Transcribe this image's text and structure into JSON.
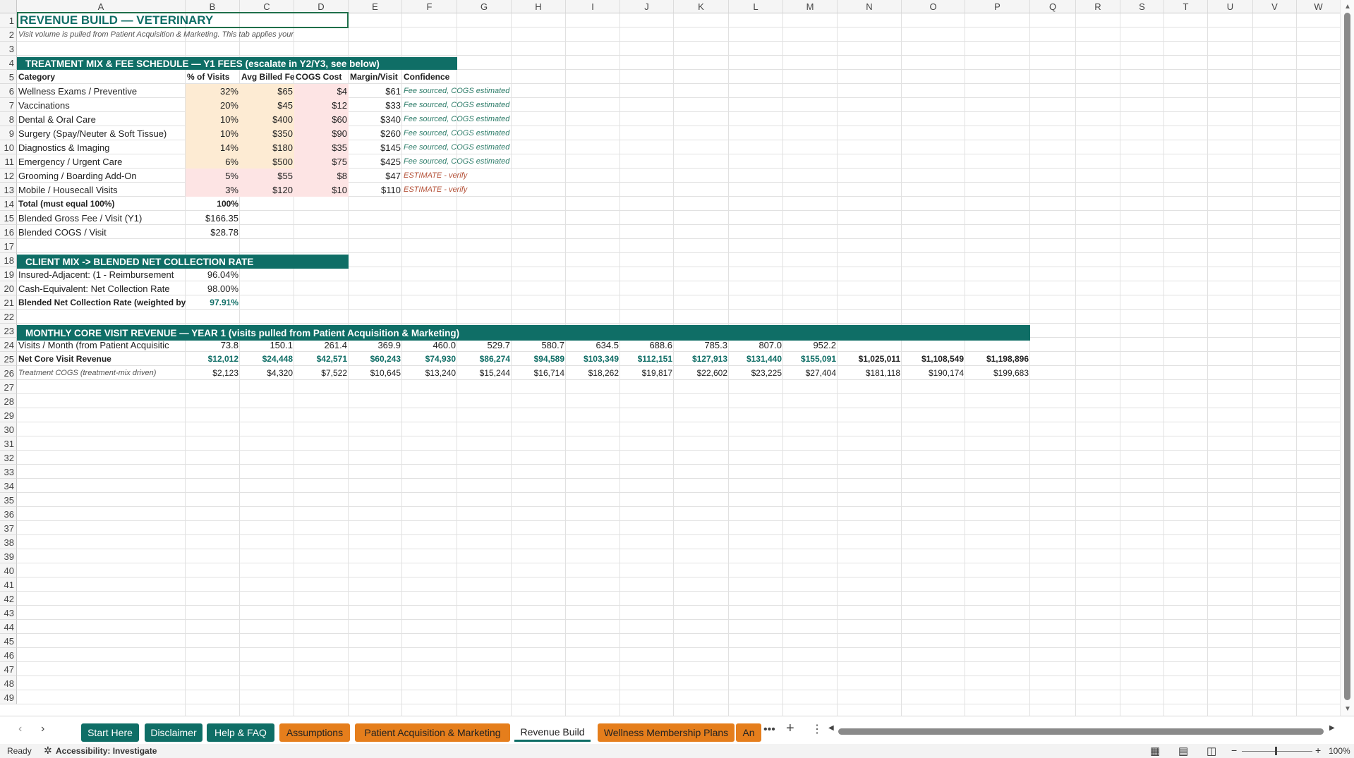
{
  "columns": [
    "A",
    "B",
    "C",
    "D",
    "E",
    "F",
    "G",
    "H",
    "I",
    "J",
    "K",
    "L",
    "M",
    "N",
    "O",
    "P",
    "Q",
    "R",
    "S",
    "T",
    "U",
    "V",
    "W"
  ],
  "rows": [
    "1",
    "2",
    "3",
    "4",
    "5",
    "6",
    "7",
    "8",
    "9",
    "10",
    "11",
    "12",
    "13",
    "14",
    "15",
    "16",
    "17",
    "18",
    "19",
    "20",
    "21",
    "22",
    "23",
    "24",
    "25",
    "26",
    "27",
    "28",
    "29",
    "30",
    "31",
    "32",
    "33",
    "34",
    "35",
    "36",
    "37",
    "38",
    "39",
    "40",
    "41",
    "42",
    "43",
    "44",
    "45",
    "46",
    "47",
    "48",
    "49"
  ],
  "title": "REVENUE BUILD — VETERINARY",
  "subtitle": "Visit volume is pulled from Patient Acquisition & Marketing. This tab applies your treatm",
  "section1": "TREATMENT MIX & FEE SCHEDULE — Y1 FEES (escalate in Y2/Y3, see below)",
  "headers": [
    "Category",
    "% of Visits",
    "Avg Billed Fee",
    "COGS Cost",
    "Margin/Visit",
    "Confidence"
  ],
  "treatments": [
    {
      "category": "Wellness Exams / Preventive",
      "pct": "32%",
      "fee": "$65",
      "cogs": "$4",
      "margin": "$61",
      "conf": "Fee sourced, COGS estimated"
    },
    {
      "category": "Vaccinations",
      "pct": "20%",
      "fee": "$45",
      "cogs": "$12",
      "margin": "$33",
      "conf": "Fee sourced, COGS estimated"
    },
    {
      "category": "Dental & Oral Care",
      "pct": "10%",
      "fee": "$400",
      "cogs": "$60",
      "margin": "$340",
      "conf": "Fee sourced, COGS estimated"
    },
    {
      "category": "Surgery (Spay/Neuter & Soft Tissue)",
      "pct": "10%",
      "fee": "$350",
      "cogs": "$90",
      "margin": "$260",
      "conf": "Fee sourced, COGS estimated"
    },
    {
      "category": "Diagnostics & Imaging",
      "pct": "14%",
      "fee": "$180",
      "cogs": "$35",
      "margin": "$145",
      "conf": "Fee sourced, COGS estimated"
    },
    {
      "category": "Emergency / Urgent Care",
      "pct": "6%",
      "fee": "$500",
      "cogs": "$75",
      "margin": "$425",
      "conf": "Fee sourced, COGS estimated"
    },
    {
      "category": "Grooming / Boarding Add-On",
      "pct": "5%",
      "fee": "$55",
      "cogs": "$8",
      "margin": "$47",
      "conf": "ESTIMATE - verify"
    },
    {
      "category": "Mobile / Housecall Visits",
      "pct": "3%",
      "fee": "$120",
      "cogs": "$10",
      "margin": "$110",
      "conf": "ESTIMATE - verify"
    }
  ],
  "total_label": "Total (must equal 100%)",
  "total_value": "100%",
  "blended_fee_label": "Blended Gross Fee / Visit (Y1)",
  "blended_fee_value": "$166.35",
  "blended_cogs_label": "Blended COGS / Visit",
  "blended_cogs_value": "$28.78",
  "section2": "CLIENT MIX -> BLENDED NET COLLECTION RATE",
  "insured_label": "Insured-Adjacent: (1 - Reimbursement",
  "insured_value": "96.04%",
  "cash_label": "Cash-Equivalent: Net Collection Rate",
  "cash_value": "98.00%",
  "blended_rate_label": "Blended Net Collection Rate (weighted by c",
  "blended_rate_value": "97.91%",
  "section3": "MONTHLY CORE VISIT REVENUE — YEAR 1 (visits pulled from Patient Acquisition & Marketing)",
  "visits_label": "Visits / Month (from Patient Acquisitic",
  "visits": [
    "73.8",
    "150.1",
    "261.4",
    "369.9",
    "460.0",
    "529.7",
    "580.7",
    "634.5",
    "688.6",
    "785.3",
    "807.0",
    "952.2"
  ],
  "net_label": "Net Core Visit Revenue",
  "net": [
    "$12,012",
    "$24,448",
    "$42,571",
    "$60,243",
    "$74,930",
    "$86,274",
    "$94,589",
    "$103,349",
    "$112,151",
    "$127,913",
    "$131,440",
    "$155,091",
    "$1,025,011",
    "$1,108,549",
    "$1,198,896"
  ],
  "cogs_label": "Treatment COGS (treatment-mix driven)",
  "cogs": [
    "$2,123",
    "$4,320",
    "$7,522",
    "$10,645",
    "$13,240",
    "$15,244",
    "$16,714",
    "$18,262",
    "$19,817",
    "$22,602",
    "$23,225",
    "$27,404",
    "$181,118",
    "$190,174",
    "$199,683"
  ],
  "tabs": [
    {
      "label": "Start Here",
      "style": "green"
    },
    {
      "label": "Disclaimer",
      "style": "green"
    },
    {
      "label": "Help & FAQ",
      "style": "green"
    },
    {
      "label": "Assumptions",
      "style": "orange"
    },
    {
      "label": "Patient Acquisition & Marketing",
      "style": "orange"
    },
    {
      "label": "Revenue Build",
      "style": "active"
    },
    {
      "label": "Wellness Membership Plans",
      "style": "orange"
    },
    {
      "label": "An",
      "style": "orange"
    }
  ],
  "status": {
    "ready": "Ready",
    "accessibility": "Accessibility: Investigate",
    "zoom": "100%"
  },
  "colors": {
    "teal": "#0f6e66",
    "orange": "#e57e1c",
    "input_fill": "#fdebd3",
    "pink_fill": "#fde4e4"
  }
}
